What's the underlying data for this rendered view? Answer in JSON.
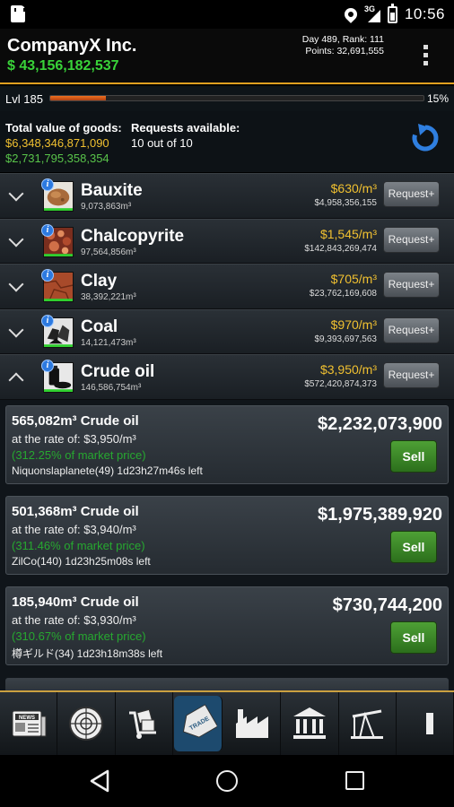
{
  "status_bar": {
    "network": "3G",
    "time": "10:56"
  },
  "header": {
    "company": "CompanyX Inc.",
    "money": "$ 43,156,182,537",
    "day_rank": "Day 489, Rank: 111",
    "points": "Points: 32,691,555"
  },
  "level": {
    "label": "Lvl 185",
    "progress_percent": 15,
    "percent_label": "15%"
  },
  "summary": {
    "total_label": "Total value of goods:",
    "total_gold": "$6,348,346,871,090",
    "total_green": "$2,731,795,358,354",
    "requests_label": "Requests available:",
    "requests_value": "10 out of 10"
  },
  "colors": {
    "accent_gold": "#f0c030",
    "money_green": "#39d339",
    "sell_green": "#3e8a28",
    "active_tab": "#1d4a6e"
  },
  "commodities": [
    {
      "name": "Bauxite",
      "qty": "9,073,863m³",
      "price": "$630/m³",
      "value": "$4,958,356,155",
      "button": "Request+",
      "expanded": false
    },
    {
      "name": "Chalcopyrite",
      "qty": "97,564,856m³",
      "price": "$1,545/m³",
      "value": "$142,843,269,474",
      "button": "Request+",
      "expanded": false
    },
    {
      "name": "Clay",
      "qty": "38,392,221m³",
      "price": "$705/m³",
      "value": "$23,762,169,608",
      "button": "Request+",
      "expanded": false
    },
    {
      "name": "Coal",
      "qty": "14,121,473m³",
      "price": "$970/m³",
      "value": "$9,393,697,563",
      "button": "Request+",
      "expanded": false
    },
    {
      "name": "Crude oil",
      "qty": "146,586,754m³",
      "price": "$3,950/m³",
      "value": "$572,420,874,373",
      "button": "Request+",
      "expanded": true
    }
  ],
  "offers": [
    {
      "title": "565,082m³ Crude oil",
      "rate": "at the rate of: $3,950/m³",
      "market": "(312.25% of market price)",
      "seller": "Niquonslaplanete(49) 1d23h27m46s left",
      "total": "$2,232,073,900",
      "sell": "Sell"
    },
    {
      "title": "501,368m³ Crude oil",
      "rate": "at the rate of: $3,940/m³",
      "market": "(311.46% of market price)",
      "seller": "ZilCo(140) 1d23h25m08s left",
      "total": "$1,975,389,920",
      "sell": "Sell"
    },
    {
      "title": "185,940m³ Crude oil",
      "rate": "at the rate of: $3,930/m³",
      "market": "(310.67% of market price)",
      "seller": "樽ギルド(34) 1d23h18m38s left",
      "total": "$730,744,200",
      "sell": "Sell"
    }
  ],
  "toolbar": {
    "news_label": "NEWS",
    "trade_label": "TRADE",
    "items": [
      "news-icon",
      "radar-icon",
      "delivery-icon",
      "trade-tag-icon",
      "factory-icon",
      "bank-icon",
      "oil-pump-icon",
      "more-icon"
    ]
  }
}
